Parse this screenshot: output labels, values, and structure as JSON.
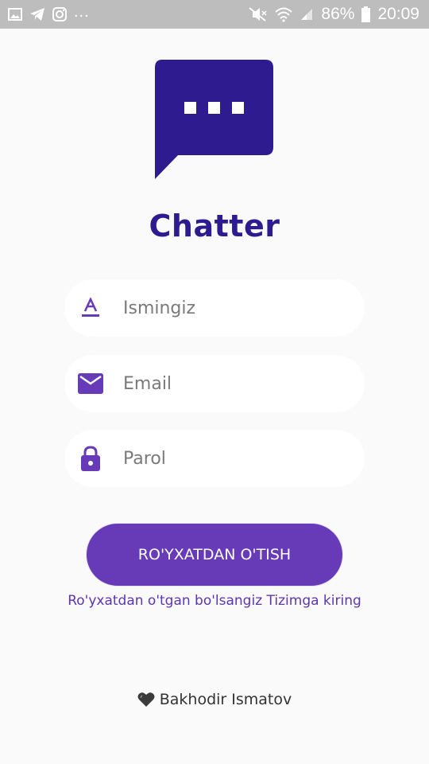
{
  "status_bar": {
    "left_icons": [
      "image-icon",
      "telegram-icon",
      "instagram-icon"
    ],
    "more": "...",
    "right_icons": [
      "mute-icon",
      "wifi-icon",
      "signal-icon"
    ],
    "battery": "86%",
    "battery_icon": "battery-icon",
    "time": "20:09"
  },
  "logo": {
    "icon": "chat-bubble-icon",
    "color": "#2d1b8f"
  },
  "app_title": "Chatter",
  "form": {
    "name": {
      "placeholder": "Ismingiz",
      "value": "",
      "icon": "text-format-icon"
    },
    "email": {
      "placeholder": "Email",
      "value": "",
      "icon": "mail-icon"
    },
    "password": {
      "placeholder": "Parol",
      "value": "",
      "icon": "lock-icon"
    }
  },
  "register_button": "RO'YXATDAN O'TISH",
  "login_link": "Ro'yxatdan o'tgan bo'lsangiz Tizimga kiring",
  "footer": {
    "icon": "heart-icon",
    "text": "Bakhodir Ismatov"
  },
  "colors": {
    "primary": "#673ab7",
    "title": "#2d1b8f",
    "status_bar": "#bdbdbd",
    "background": "#fafafa"
  }
}
